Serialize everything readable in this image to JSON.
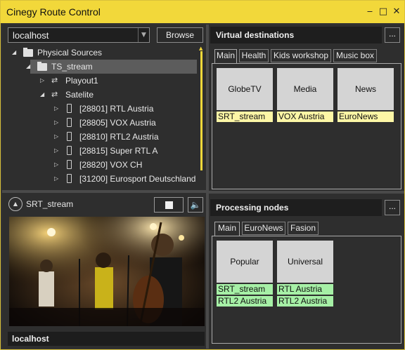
{
  "window": {
    "title": "Cinegy Route Control",
    "min_glyph": "‒",
    "max_glyph": "□",
    "close_glyph": "✕"
  },
  "source": {
    "server": "localhost",
    "browse_label": "Browse"
  },
  "tree": [
    {
      "label": "Physical Sources",
      "level": 0,
      "kind": "folder",
      "expander": "◢"
    },
    {
      "label": "TS_stream",
      "level": 1,
      "kind": "folder",
      "expander": "◢",
      "selected": true
    },
    {
      "label": "Playout1",
      "level": 2,
      "kind": "route",
      "expander": "▷"
    },
    {
      "label": "Satelite",
      "level": 2,
      "kind": "route",
      "expander": "◢"
    },
    {
      "label": "[28801] RTL Austria",
      "level": 3,
      "kind": "channel",
      "expander": "▷"
    },
    {
      "label": "[28805] VOX Austria",
      "level": 3,
      "kind": "channel",
      "expander": "▷"
    },
    {
      "label": "[28810] RTL2 Austria",
      "level": 3,
      "kind": "channel",
      "expander": "▷"
    },
    {
      "label": "[28815] Super RTL A",
      "level": 3,
      "kind": "channel",
      "expander": "▷"
    },
    {
      "label": "[28820] VOX CH",
      "level": 3,
      "kind": "channel",
      "expander": "▷"
    },
    {
      "label": "[31200] Eurosport Deutschland",
      "level": 3,
      "kind": "channel",
      "expander": "▷"
    }
  ],
  "preview": {
    "name": "SRT_stream",
    "host": "localhost",
    "collapse_glyph": "▲",
    "mute_glyph": "🔇"
  },
  "virtual_destinations": {
    "title": "Virtual destinations",
    "more_label": "...",
    "tabs": [
      "Main",
      "Health",
      "Kids workshop",
      "Music box"
    ],
    "active_tab": 0,
    "cards": [
      {
        "name": "GlobeTV",
        "tags": [
          "SRT_stream"
        ]
      },
      {
        "name": "Media",
        "tags": [
          "VOX Austria"
        ]
      },
      {
        "name": "News",
        "tags": [
          "EuroNews"
        ]
      }
    ]
  },
  "processing_nodes": {
    "title": "Processing nodes",
    "more_label": "...",
    "tabs": [
      "Main",
      "EuroNews",
      "Fasion"
    ],
    "active_tab": 0,
    "cards": [
      {
        "name": "Popular",
        "tags": [
          "SRT_stream",
          "RTL2 Austria"
        ]
      },
      {
        "name": "Universal",
        "tags": [
          "RTL Austria",
          "RTL2 Austria"
        ]
      }
    ]
  },
  "colors": {
    "accent": "#f2d83a",
    "destination_tag": "#fdf6a6",
    "node_tag": "#a6f0a6",
    "card": "#d4d4d4"
  },
  "icons": {
    "folder": "folder-icon",
    "route": "route-arrows-icon",
    "channel": "channel-device-icon"
  }
}
